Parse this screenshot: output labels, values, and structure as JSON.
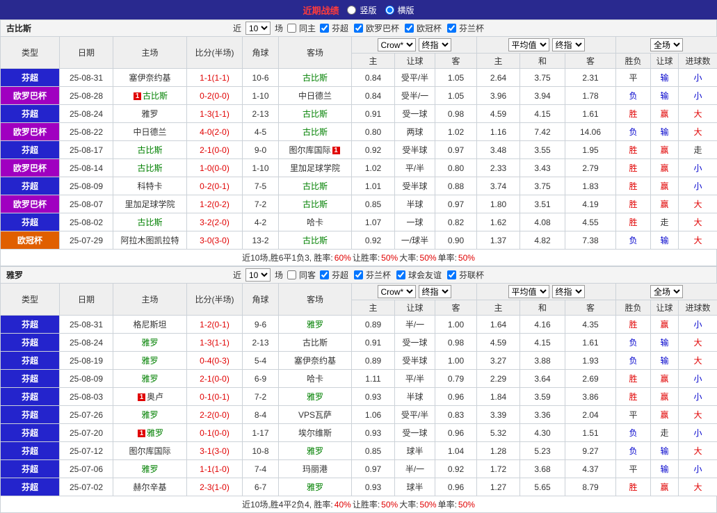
{
  "topbar": {
    "title": "近期战绩",
    "vertical": "竖版",
    "horizontal": "横版"
  },
  "header": {
    "cols": [
      "类型",
      "日期",
      "主场",
      "比分(半场)",
      "角球",
      "客场"
    ],
    "bookmaker": "Crow*",
    "final_odds": "终指",
    "average": "平均值",
    "fulltime": "全场",
    "odds_sub": [
      "主",
      "让球",
      "客"
    ],
    "avg_sub": [
      "主",
      "和",
      "客"
    ],
    "full_sub": [
      "胜负",
      "让球",
      "进球数"
    ]
  },
  "league_colors": {
    "芬超": "#2424cc",
    "欧罗巴杯": "#a000c0",
    "欧冠杯": "#e05f00",
    "芬兰杯": "#2424cc",
    "球会友谊": "#2424cc",
    "芬联杯": "#2424cc"
  },
  "sections": [
    {
      "team": "古比斯",
      "filter": {
        "near": "近",
        "count": "10",
        "games": "场",
        "same": "同主",
        "same_checked": false,
        "leagues": [
          "芬超",
          "欧罗巴杯",
          "欧冠杯",
          "芬兰杯"
        ]
      },
      "rows": [
        {
          "lg": "芬超",
          "date": "25-08-31",
          "home": "塞伊奈约基",
          "away": "古比斯",
          "tg": "away",
          "score": "1-1(1-1)",
          "corners": "10-6",
          "o1": "0.84",
          "hd": "受平/半",
          "o2": "1.05",
          "a1": "2.64",
          "a2": "3.75",
          "a3": "2.31",
          "res": "平",
          "hres": "输",
          "gres": "小"
        },
        {
          "lg": "欧罗巴杯",
          "date": "25-08-28",
          "home": "古比斯",
          "hcard": true,
          "away": "中日德兰",
          "tg": "home",
          "score": "0-2(0-0)",
          "corners": "1-10",
          "o1": "0.84",
          "hd": "受半/一",
          "o2": "1.05",
          "a1": "3.96",
          "a2": "3.94",
          "a3": "1.78",
          "res": "负",
          "hres": "输",
          "gres": "小"
        },
        {
          "lg": "芬超",
          "date": "25-08-24",
          "home": "雅罗",
          "away": "古比斯",
          "tg": "away",
          "score": "1-3(1-1)",
          "corners": "2-13",
          "o1": "0.91",
          "hd": "受一球",
          "o2": "0.98",
          "a1": "4.59",
          "a2": "4.15",
          "a3": "1.61",
          "res": "胜",
          "hres": "赢",
          "gres": "大"
        },
        {
          "lg": "欧罗巴杯",
          "date": "25-08-22",
          "home": "中日德兰",
          "away": "古比斯",
          "tg": "away",
          "score": "4-0(2-0)",
          "corners": "4-5",
          "o1": "0.80",
          "hd": "两球",
          "o2": "1.02",
          "a1": "1.16",
          "a2": "7.42",
          "a3": "14.06",
          "res": "负",
          "hres": "输",
          "gres": "大"
        },
        {
          "lg": "芬超",
          "date": "25-08-17",
          "home": "古比斯",
          "tg": "home",
          "away": "图尔库国际",
          "acard": true,
          "score": "2-1(0-0)",
          "corners": "9-0",
          "o1": "0.92",
          "hd": "受半球",
          "o2": "0.97",
          "a1": "3.48",
          "a2": "3.55",
          "a3": "1.95",
          "res": "胜",
          "hres": "赢",
          "gres": "走"
        },
        {
          "lg": "欧罗巴杯",
          "date": "25-08-14",
          "home": "古比斯",
          "tg": "home",
          "away": "里加足球学院",
          "score": "1-0(0-0)",
          "corners": "1-10",
          "o1": "1.02",
          "hd": "平/半",
          "o2": "0.80",
          "a1": "2.33",
          "a2": "3.43",
          "a3": "2.79",
          "res": "胜",
          "hres": "赢",
          "gres": "小"
        },
        {
          "lg": "芬超",
          "date": "25-08-09",
          "home": "科特卡",
          "away": "古比斯",
          "tg": "away",
          "score": "0-2(0-1)",
          "corners": "7-5",
          "o1": "1.01",
          "hd": "受半球",
          "o2": "0.88",
          "a1": "3.74",
          "a2": "3.75",
          "a3": "1.83",
          "res": "胜",
          "hres": "赢",
          "gres": "小"
        },
        {
          "lg": "欧罗巴杯",
          "date": "25-08-07",
          "home": "里加足球学院",
          "away": "古比斯",
          "tg": "away",
          "score": "1-2(0-2)",
          "corners": "7-2",
          "o1": "0.85",
          "hd": "半球",
          "o2": "0.97",
          "a1": "1.80",
          "a2": "3.51",
          "a3": "4.19",
          "res": "胜",
          "hres": "赢",
          "gres": "大"
        },
        {
          "lg": "芬超",
          "date": "25-08-02",
          "home": "古比斯",
          "tg": "home",
          "away": "哈卡",
          "score": "3-2(2-0)",
          "corners": "4-2",
          "o1": "1.07",
          "hd": "一球",
          "o2": "0.82",
          "a1": "1.62",
          "a2": "4.08",
          "a3": "4.55",
          "res": "胜",
          "hres": "走",
          "gres": "大"
        },
        {
          "lg": "欧冠杯",
          "date": "25-07-29",
          "home": "阿拉木图凯拉特",
          "away": "古比斯",
          "tg": "away",
          "score": "3-0(3-0)",
          "corners": "13-2",
          "o1": "0.92",
          "hd": "一/球半",
          "o2": "0.90",
          "a1": "1.37",
          "a2": "4.82",
          "a3": "7.38",
          "res": "负",
          "hres": "输",
          "gres": "大"
        }
      ],
      "summary": [
        {
          "t": "近10场,胜6平1负3, 胜率:",
          "c": "k"
        },
        {
          "t": "60%",
          "c": "r"
        },
        {
          "t": " 让胜率:",
          "c": "k"
        },
        {
          "t": "50%",
          "c": "r"
        },
        {
          "t": " 大率:",
          "c": "k"
        },
        {
          "t": "50%",
          "c": "r"
        },
        {
          "t": " 单率:",
          "c": "k"
        },
        {
          "t": "50%",
          "c": "r"
        }
      ]
    },
    {
      "team": "雅罗",
      "filter": {
        "near": "近",
        "count": "10",
        "games": "场",
        "same": "同客",
        "same_checked": false,
        "leagues": [
          "芬超",
          "芬兰杯",
          "球会友谊",
          "芬联杯"
        ]
      },
      "rows": [
        {
          "lg": "芬超",
          "date": "25-08-31",
          "home": "格尼斯坦",
          "away": "雅罗",
          "tg": "away",
          "score": "1-2(0-1)",
          "corners": "9-6",
          "o1": "0.89",
          "hd": "半/一",
          "o2": "1.00",
          "a1": "1.64",
          "a2": "4.16",
          "a3": "4.35",
          "res": "胜",
          "hres": "赢",
          "gres": "小"
        },
        {
          "lg": "芬超",
          "date": "25-08-24",
          "home": "雅罗",
          "tg": "home",
          "away": "古比斯",
          "score": "1-3(1-1)",
          "corners": "2-13",
          "o1": "0.91",
          "hd": "受一球",
          "o2": "0.98",
          "a1": "4.59",
          "a2": "4.15",
          "a3": "1.61",
          "res": "负",
          "hres": "输",
          "gres": "大"
        },
        {
          "lg": "芬超",
          "date": "25-08-19",
          "home": "雅罗",
          "tg": "home",
          "away": "塞伊奈约基",
          "score": "0-4(0-3)",
          "corners": "5-4",
          "o1": "0.89",
          "hd": "受半球",
          "o2": "1.00",
          "a1": "3.27",
          "a2": "3.88",
          "a3": "1.93",
          "res": "负",
          "hres": "输",
          "gres": "大"
        },
        {
          "lg": "芬超",
          "date": "25-08-09",
          "home": "雅罗",
          "tg": "home",
          "away": "哈卡",
          "score": "2-1(0-0)",
          "corners": "6-9",
          "o1": "1.11",
          "hd": "平/半",
          "o2": "0.79",
          "a1": "2.29",
          "a2": "3.64",
          "a3": "2.69",
          "res": "胜",
          "hres": "赢",
          "gres": "小"
        },
        {
          "lg": "芬超",
          "date": "25-08-03",
          "home": "奥卢",
          "hcard": true,
          "away": "雅罗",
          "tg": "away",
          "score": "0-1(0-1)",
          "corners": "7-2",
          "o1": "0.93",
          "hd": "半球",
          "o2": "0.96",
          "a1": "1.84",
          "a2": "3.59",
          "a3": "3.86",
          "res": "胜",
          "hres": "赢",
          "gres": "小"
        },
        {
          "lg": "芬超",
          "date": "25-07-26",
          "home": "雅罗",
          "tg": "home",
          "away": "VPS瓦萨",
          "score": "2-2(0-0)",
          "corners": "8-4",
          "o1": "1.06",
          "hd": "受平/半",
          "o2": "0.83",
          "a1": "3.39",
          "a2": "3.36",
          "a3": "2.04",
          "res": "平",
          "hres": "赢",
          "gres": "大"
        },
        {
          "lg": "芬超",
          "date": "25-07-20",
          "home": "雅罗",
          "tg": "home",
          "hcard": true,
          "away": "埃尔维斯",
          "score": "0-1(0-0)",
          "corners": "1-17",
          "o1": "0.93",
          "hd": "受一球",
          "o2": "0.96",
          "a1": "5.32",
          "a2": "4.30",
          "a3": "1.51",
          "res": "负",
          "hres": "走",
          "gres": "小"
        },
        {
          "lg": "芬超",
          "date": "25-07-12",
          "home": "图尔库国际",
          "away": "雅罗",
          "tg": "away",
          "score": "3-1(3-0)",
          "corners": "10-8",
          "o1": "0.85",
          "hd": "球半",
          "o2": "1.04",
          "a1": "1.28",
          "a2": "5.23",
          "a3": "9.27",
          "res": "负",
          "hres": "输",
          "gres": "大"
        },
        {
          "lg": "芬超",
          "date": "25-07-06",
          "home": "雅罗",
          "tg": "home",
          "away": "玛丽港",
          "score": "1-1(1-0)",
          "corners": "7-4",
          "o1": "0.97",
          "hd": "半/一",
          "o2": "0.92",
          "a1": "1.72",
          "a2": "3.68",
          "a3": "4.37",
          "res": "平",
          "hres": "输",
          "gres": "小"
        },
        {
          "lg": "芬超",
          "date": "25-07-02",
          "home": "赫尔辛基",
          "away": "雅罗",
          "tg": "away",
          "score": "2-3(1-0)",
          "corners": "6-7",
          "o1": "0.93",
          "hd": "球半",
          "o2": "0.96",
          "a1": "1.27",
          "a2": "5.65",
          "a3": "8.79",
          "res": "胜",
          "hres": "赢",
          "gres": "大"
        }
      ],
      "summary": [
        {
          "t": "近10场,胜4平2负4, 胜率:",
          "c": "k"
        },
        {
          "t": "40%",
          "c": "r"
        },
        {
          "t": " 让胜率:",
          "c": "k"
        },
        {
          "t": "50%",
          "c": "r"
        },
        {
          "t": " 大率:",
          "c": "k"
        },
        {
          "t": "50%",
          "c": "r"
        },
        {
          "t": " 单率:",
          "c": "k"
        },
        {
          "t": "50%",
          "c": "r"
        }
      ]
    }
  ]
}
